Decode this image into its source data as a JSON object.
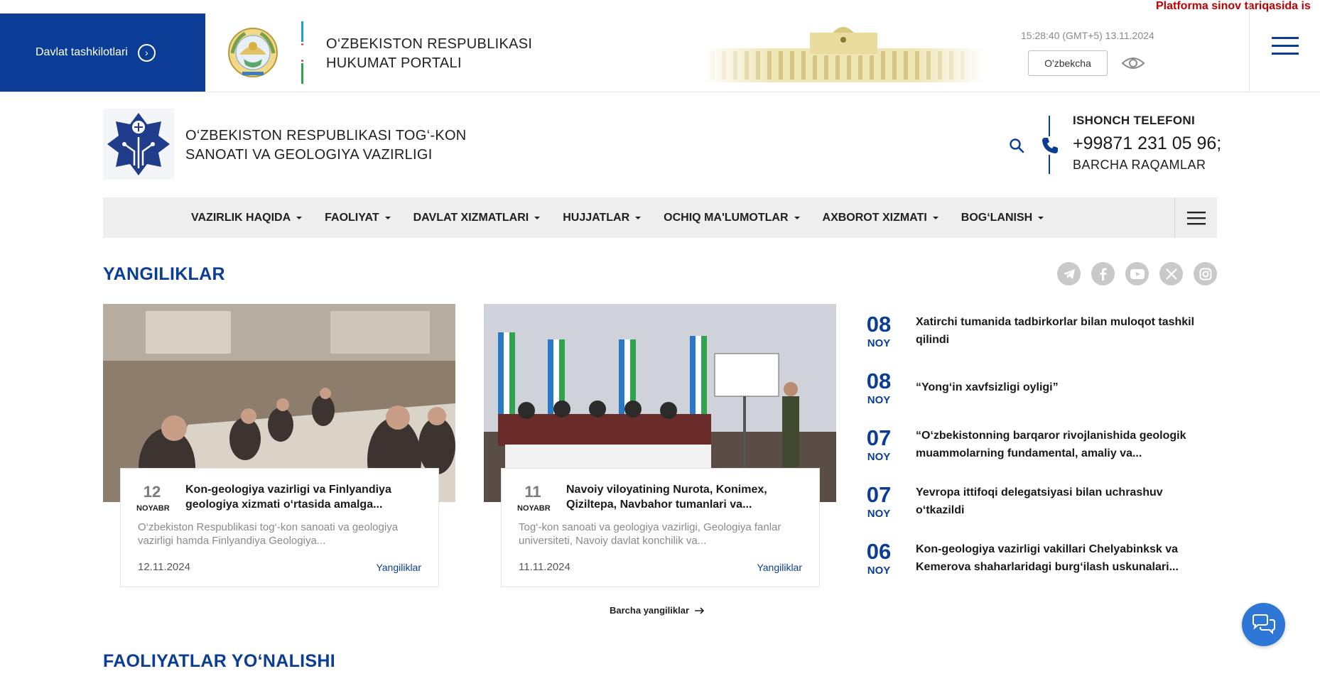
{
  "topbar": {
    "org_button_label": "Davlat tashkilotlari",
    "portal_title_line1": "O‘ZBEKISTON RESPUBLIKASI",
    "portal_title_line2": "HUKUMAT PORTALI",
    "clock": "15:28:40 (GMT+5) 13.11.2024",
    "language": "O'zbekcha",
    "ticker": "Platforma sinov tariqasida is"
  },
  "header": {
    "ministry_line1": "O‘ZBEKISTON RESPUBLIKASI TOG‘-KON",
    "ministry_line2": "SANOATI VA GEOLOGIYA VAZIRLIGI",
    "hotline_label": "ISHONCH TELEFONI",
    "hotline_number": "+99871 231 05 96;",
    "hotline_all": "BARCHA RAQAMLAR"
  },
  "nav": {
    "items": [
      {
        "label": "VAZIRLIK HAQIDA"
      },
      {
        "label": "FAOLIYAT"
      },
      {
        "label": "DAVLAT XIZMATLARI"
      },
      {
        "label": "HUJJATLAR"
      },
      {
        "label": "OCHIQ MA'LUMOTLAR"
      },
      {
        "label": "AXBOROT XIZMATI"
      },
      {
        "label": "BOG‘LANISH"
      }
    ]
  },
  "news": {
    "section_title": "YANGILIKLAR",
    "socials": [
      "telegram-icon",
      "facebook-icon",
      "youtube-icon",
      "x-icon",
      "instagram-icon"
    ],
    "cards": [
      {
        "day": "12",
        "month": "NOYABR",
        "title": "Kon-geologiya vazirligi va Finlyandiya geologiya xizmati o‘rtasida amalga...",
        "desc": "O‘zbekiston Respublikasi tog‘-kon sanoati va geologiya vazirligi hamda Finlyandiya Geologiya...",
        "date": "12.11.2024",
        "category": "Yangiliklar"
      },
      {
        "day": "11",
        "month": "NOYABR",
        "title": "Navoiy viloyatining Nurota, Konimex, Qiziltepa, Navbahor tumanlari va...",
        "desc": "Tog‘-kon sanoati va geologiya vazirligi, Geologiya fanlar universiteti, Navoiy davlat konchilik va...",
        "date": "11.11.2024",
        "category": "Yangiliklar"
      }
    ],
    "list": [
      {
        "day": "08",
        "month": "NOY",
        "title": "Xatirchi tumanida tadbirkorlar bilan muloqot tashkil qilindi"
      },
      {
        "day": "08",
        "month": "NOY",
        "title": "“Yong‘in xavfsizligi oyligi”"
      },
      {
        "day": "07",
        "month": "NOY",
        "title": "“O‘zbekistonning barqaror rivojlanishida geologik muammolarning fundamental, amaliy va..."
      },
      {
        "day": "07",
        "month": "NOY",
        "title": "Yevropa ittifoqi delegatsiyasi bilan uchrashuv o‘tkazildi"
      },
      {
        "day": "06",
        "month": "NOY",
        "title": "Kon-geologiya vazirligi vakillari Chelyabinksk va Kemerova shaharlaridagi burg‘ilash uskunalari..."
      }
    ],
    "all_link": "Barcha yangiliklar"
  },
  "activities": {
    "section_title": "FAOLIYATLAR YO‘NALISHI"
  },
  "colors": {
    "brand_blue": "#0b3d97",
    "ticker_red": "#c00000",
    "chat_blue": "#2f77d6"
  }
}
